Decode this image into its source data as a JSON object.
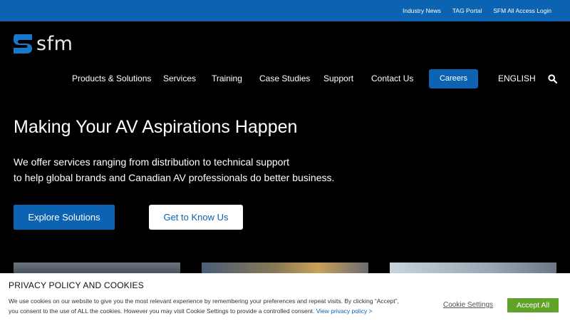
{
  "topbar": {
    "links": [
      "Industry News",
      "TAG Portal",
      "SFM All Access Login"
    ]
  },
  "brand": {
    "logo_text": "sfm"
  },
  "nav": {
    "items": [
      "Products & Solutions",
      "Services",
      "Training",
      "Case Studies",
      "Support",
      "Contact Us"
    ],
    "careers": "Careers",
    "language": "ENGLISH"
  },
  "hero": {
    "title": "Making Your AV Aspirations Happen",
    "subtitle_line1": "We offer services ranging from distribution to technical support",
    "subtitle_line2": "to help global brands and Canadian AV professionals do better business.",
    "primary_button": "Explore Solutions",
    "secondary_button": "Get to Know Us"
  },
  "cookie": {
    "title": "PRIVACY POLICY AND COOKIES",
    "text": "We use cookies on our website to give you the most relevant experience by remembering your preferences and repeat visits. By clicking “Accept”, you consent to the use of ALL the cookies. However you may visit Cookie Settings to provide a controlled consent.",
    "policy_link": "View privacy policy >",
    "settings_label": "Cookie Settings",
    "accept_label": "Accept All"
  },
  "colors": {
    "primary_blue": "#0b63b1",
    "accept_green": "#61a229",
    "background": "#000000"
  },
  "icons": [
    "sfm-logo-mark",
    "search-icon"
  ]
}
